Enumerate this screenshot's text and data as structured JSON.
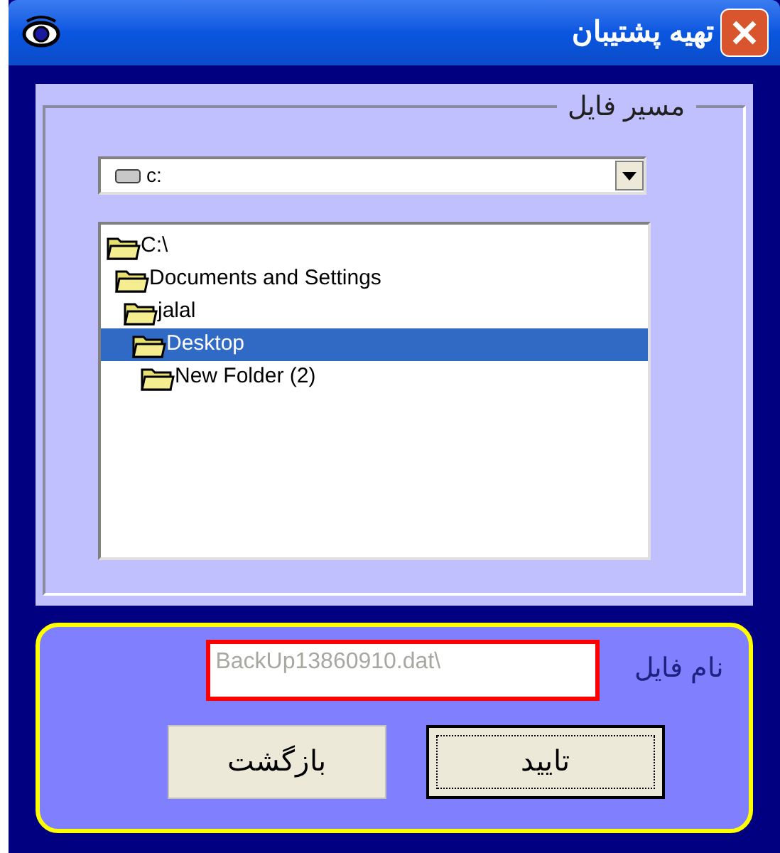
{
  "window": {
    "title": "تهیه پشتیبان"
  },
  "path_group": {
    "label": "مسیر فایل",
    "drive": "c:",
    "tree": [
      {
        "label": "C:\\",
        "selected": false,
        "children": [
          {
            "label": "Documents and Settings",
            "selected": false,
            "children": [
              {
                "label": "jalal",
                "selected": false,
                "children": [
                  {
                    "label": "Desktop",
                    "selected": true,
                    "children": [
                      {
                        "label": "New Folder (2)",
                        "selected": false
                      }
                    ]
                  }
                ]
              }
            ]
          }
        ]
      }
    ]
  },
  "file_name": {
    "label": "نام فایل",
    "placeholder": "BackUp13860910.dat\\"
  },
  "buttons": [
    {
      "label": "تایید",
      "focused": true
    },
    {
      "label": "بازگشت",
      "focused": false
    }
  ]
}
